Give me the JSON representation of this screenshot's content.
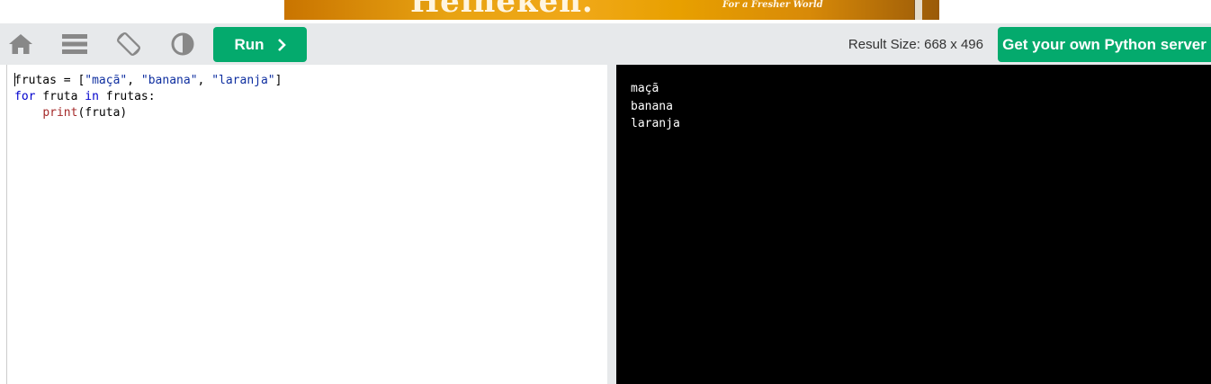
{
  "ad": {
    "brand": "Heineken.",
    "tagline": "For a Fresher World"
  },
  "toolbar": {
    "icons": [
      "home-icon",
      "menu-icon",
      "rotate-icon",
      "contrast-icon"
    ],
    "run_label": "Run",
    "result_size": "Result Size: 668 x 496",
    "server_label": "Get your own Python server"
  },
  "editor": {
    "line1": {
      "var": "frutas",
      "op": " = [",
      "s1": "\"maçã\"",
      "sep1": ", ",
      "s2": "\"banana\"",
      "sep2": ", ",
      "s3": "\"laranja\"",
      "close": "]"
    },
    "line2": {
      "kw_for": "for",
      "mid1": " fruta ",
      "kw_in": "in",
      "mid2": " frutas:"
    },
    "line3": {
      "indent": "    ",
      "fn": "print",
      "args": "(fruta)"
    }
  },
  "result": {
    "lines": [
      "maçã",
      "banana",
      "laranja"
    ]
  },
  "colors": {
    "accent": "#04aa6d",
    "toolbar_bg": "#e7e9eb",
    "icon_gray": "#888888"
  }
}
